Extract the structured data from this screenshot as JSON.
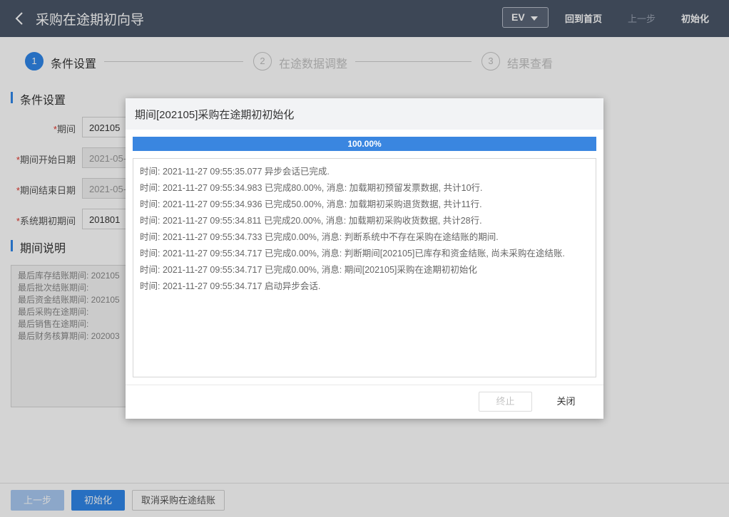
{
  "header": {
    "title": "采购在途期初向导",
    "env": "EV",
    "home": "回到首页",
    "prev": "上一步",
    "init": "初始化"
  },
  "steps": [
    {
      "num": "1",
      "label": "条件设置"
    },
    {
      "num": "2",
      "label": "在途数据调整"
    },
    {
      "num": "3",
      "label": "结果查看"
    }
  ],
  "conditions": {
    "section_title": "条件设置",
    "period_label": "期间",
    "period_value": "202105",
    "start_label": "期间开始日期",
    "start_value": "2021-05-",
    "end_label": "期间结束日期",
    "end_value": "2021-05-",
    "sys_label": "系统期初期间",
    "sys_value": "201801"
  },
  "period_desc": {
    "section_title": "期间说明",
    "lines": [
      "最后库存结账期间: 202105",
      "最后批次结账期间:",
      "最后资金结账期间: 202105",
      "最后采购在途期间:",
      "最后销售在途期间:",
      "最后财务核算期间: 202003"
    ]
  },
  "footer": {
    "prev": "上一步",
    "init": "初始化",
    "cancel": "取消采购在途结账"
  },
  "dialog": {
    "title": "期间[202105]采购在途期初初始化",
    "progress_text": "100.00%",
    "progress_value": 100,
    "logs": [
      "时间: 2021-11-27 09:55:35.077 异步会话已完成.",
      "时间: 2021-11-27 09:55:34.983 已完成80.00%, 消息: 加载期初预留发票数据, 共计10行.",
      "时间: 2021-11-27 09:55:34.936 已完成50.00%, 消息: 加载期初采购退货数据, 共计11行.",
      "时间: 2021-11-27 09:55:34.811 已完成20.00%, 消息: 加载期初采购收货数据, 共计28行.",
      "时间: 2021-11-27 09:55:34.733 已完成0.00%, 消息: 判断系统中不存在采购在途结账的期间.",
      "时间: 2021-11-27 09:55:34.717 已完成0.00%, 消息: 判断期间[202105]已库存和资金结账, 尚未采购在途结账.",
      "时间: 2021-11-27 09:55:34.717 已完成0.00%, 消息: 期间[202105]采购在途期初初始化",
      "时间: 2021-11-27 09:55:34.717 启动异步会话."
    ],
    "stop": "终止",
    "close": "关闭"
  }
}
